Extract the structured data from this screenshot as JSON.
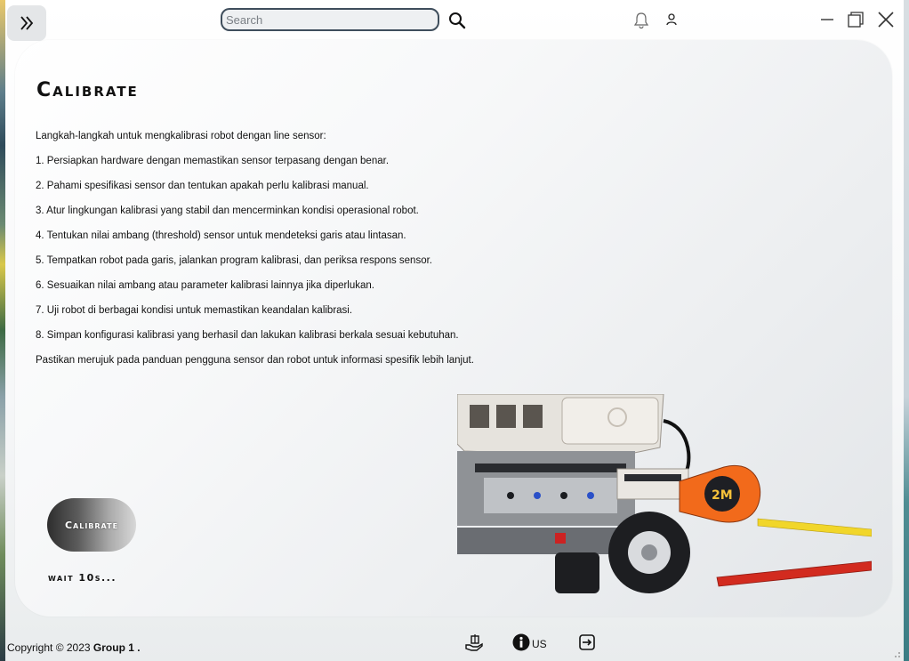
{
  "header": {
    "menu_icon": "double-chevron-right-icon",
    "search_placeholder": "Search",
    "search_value": "",
    "icons": [
      "search-icon",
      "bell-icon",
      "user-icon"
    ],
    "window_controls": [
      "minimize-icon",
      "maximize-icon",
      "close-icon"
    ]
  },
  "main": {
    "title": "Calibrate",
    "intro": "Langkah-langkah untuk mengkalibrasi robot dengan line sensor:",
    "steps": [
      "1. Persiapkan hardware dengan memastikan sensor terpasang dengan benar.",
      "2. Pahami spesifikasi sensor dan tentukan apakah perlu kalibrasi manual.",
      "3. Atur lingkungan kalibrasi yang stabil dan mencerminkan kondisi operasional robot.",
      "4. Tentukan nilai ambang (threshold) sensor untuk mendeteksi garis atau lintasan.",
      "5. Tempatkan robot pada garis, jalankan program kalibrasi, dan periksa respons sensor.",
      "6. Sesuaikan nilai ambang atau parameter kalibrasi lainnya jika diperlukan.",
      "7. Uji robot di berbagai kondisi untuk memastikan keandalan kalibrasi.",
      "8. Simpan konfigurasi kalibrasi yang berhasil dan lakukan kalibrasi berkala sesuai kebutuhan."
    ],
    "outro": "Pastikan merujuk pada panduan pengguna sensor dan robot untuk informasi spesifik lebih lanjut.",
    "calibrate_button": "Calibrate",
    "wait_text": "wait 10s...",
    "image_text": "2M"
  },
  "footer": {
    "copyright_prefix": "Copyright © 2023 ",
    "copyright_owner": "Group 1 .",
    "info_label": "US",
    "icons": [
      "donate-icon",
      "info-icon",
      "logout-icon"
    ]
  },
  "colors": {
    "search_border": "#3f4e5c",
    "button_dark": "#2e2e2e",
    "tape_orange": "#f26a1b"
  }
}
